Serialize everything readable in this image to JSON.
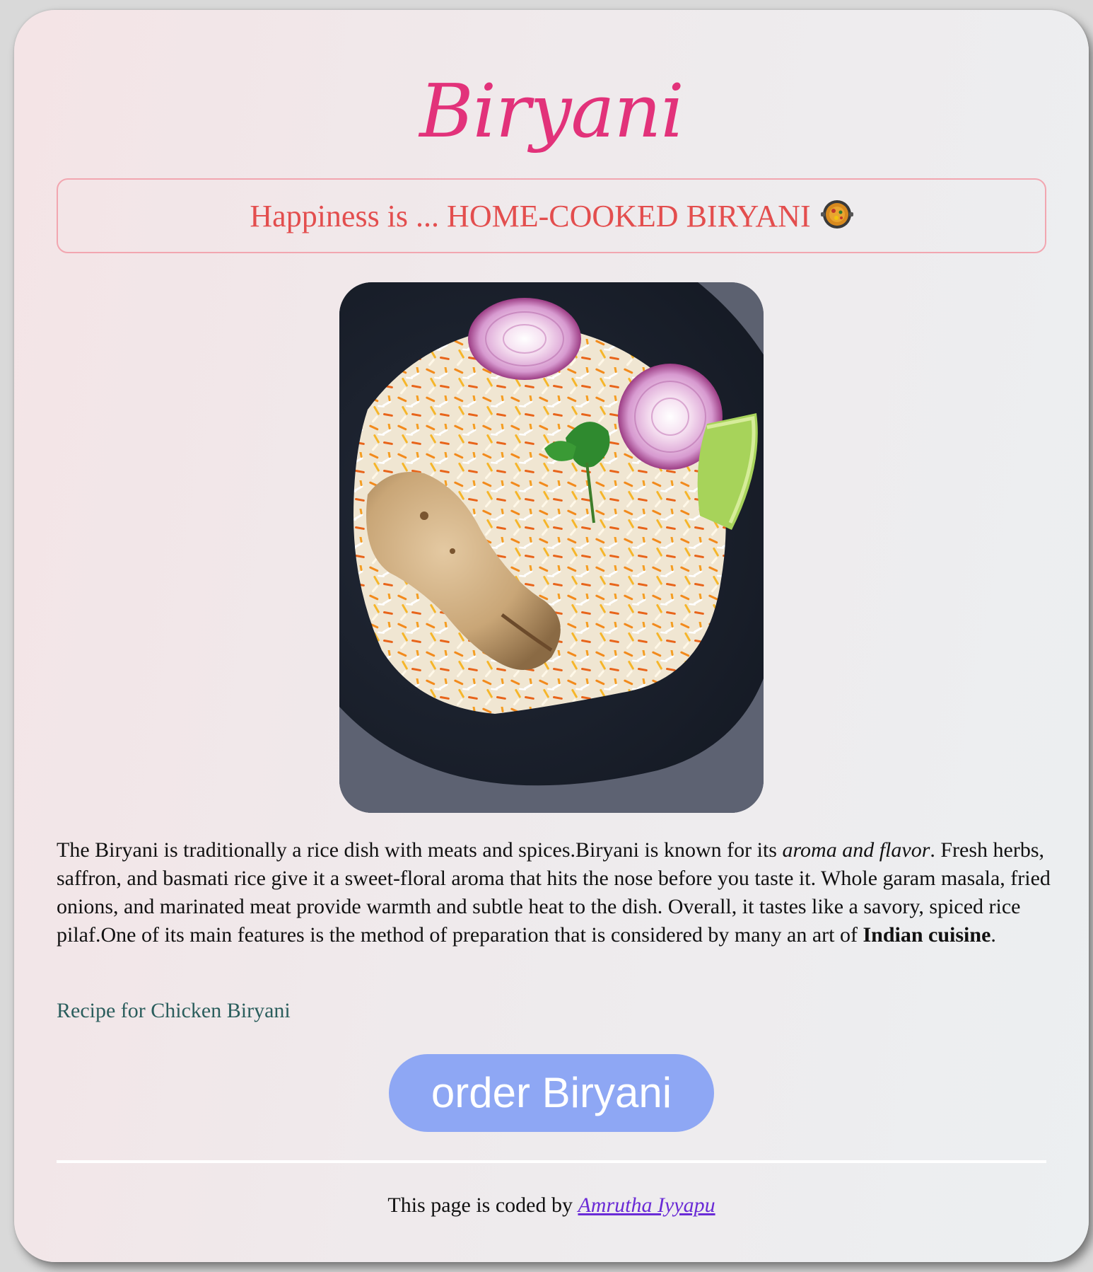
{
  "page": {
    "title": "Biryani",
    "tagline": "Happiness is ... HOME-COOKED BIRYANI",
    "tagline_icon": "paella-pan-icon",
    "image_alt": "Chicken biryani on a black plate with onion rings and lime"
  },
  "description": {
    "part1": "The Biryani is traditionally a rice dish with meats and spices.Biryani is known for its ",
    "emphasis": "aroma and flavor",
    "part2": ". Fresh herbs, saffron, and basmati rice give it a sweet-floral aroma that hits the nose before you taste it. Whole garam masala, fried onions, and marinated meat provide warmth and subtle heat to the dish. Overall, it tastes like a savory, spiced rice pilaf.One of its main features is the method of preparation that is considered by many an art of ",
    "strong": "Indian cuisine",
    "part3": "."
  },
  "recipe_link": "Recipe for Chicken Biryani",
  "order_button": "order Biryani",
  "footer": {
    "text": "This page is coded by ",
    "author": "Amrutha Iyyapu"
  },
  "colors": {
    "title": "#e2327a",
    "tagline": "#e34e4e",
    "tagline_border": "#f2a6b0",
    "link": "#2b5e5d",
    "button": "#8ea7f4",
    "author_link": "#6a2bd6"
  }
}
